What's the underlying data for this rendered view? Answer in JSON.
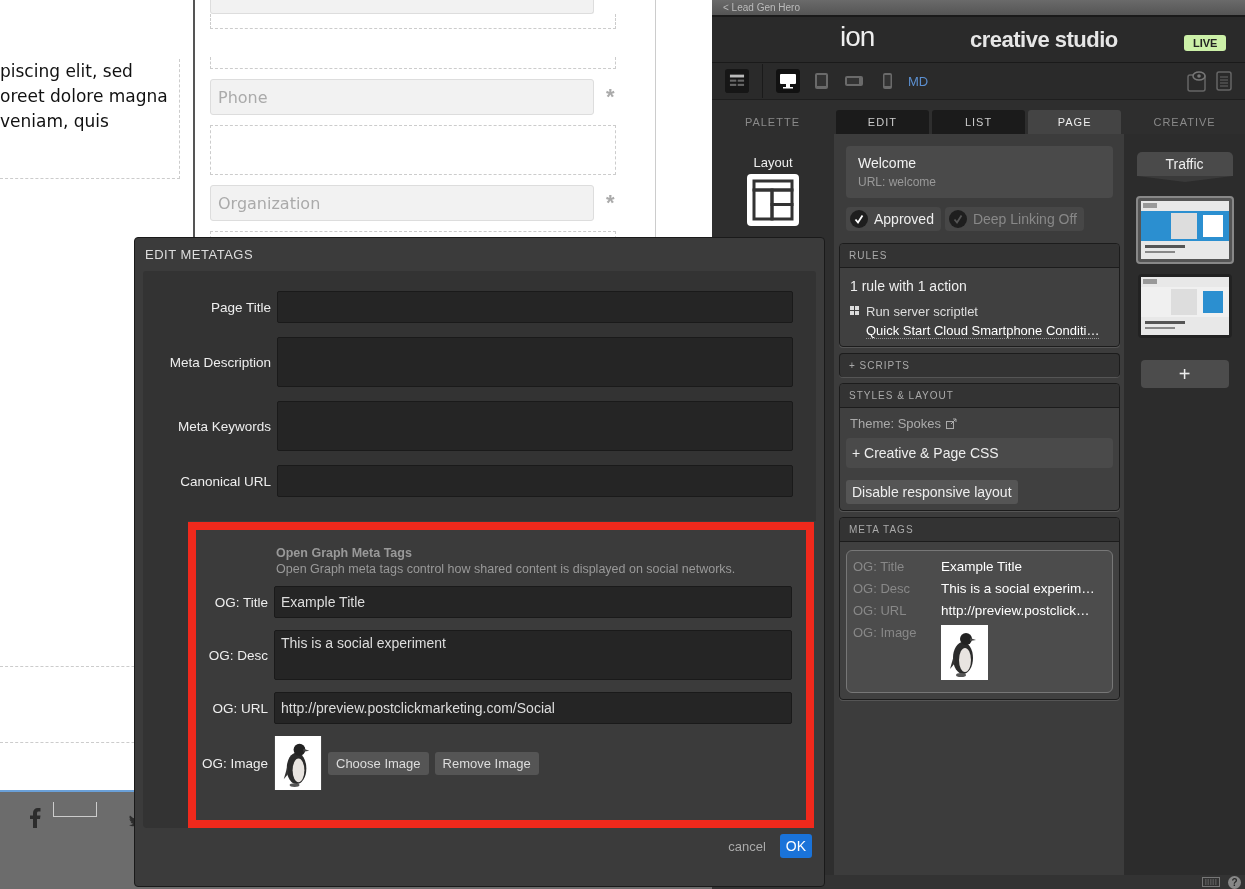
{
  "canvas": {
    "paragraph_lines": [
      "piscing elit, sed",
      "oreet dolore magna",
      "veniam, quis"
    ],
    "fields": [
      {
        "placeholder": "Phone",
        "mark": "*"
      },
      {
        "placeholder": "Organization",
        "mark": "*"
      }
    ]
  },
  "studio": {
    "back_link": "< Lead Gen Hero",
    "logo": "ion",
    "title": "creative studio",
    "status": "LIVE",
    "devices": [
      {
        "kind": "desktop",
        "selected": true
      },
      {
        "kind": "tablet",
        "selected": false
      },
      {
        "kind": "landscape",
        "selected": false
      },
      {
        "kind": "phone",
        "selected": false
      }
    ],
    "breakpoint": "MD",
    "tabs": [
      {
        "label": "PALETTE",
        "kind": "plain",
        "selected": false
      },
      {
        "label": "EDIT",
        "kind": "tab",
        "selected": false
      },
      {
        "label": "LIST",
        "kind": "tab",
        "selected": false
      },
      {
        "label": "PAGE",
        "kind": "tab",
        "selected": true
      },
      {
        "label": "CREATIVE",
        "kind": "plain",
        "selected": false
      }
    ],
    "layout_label": "Layout",
    "page": {
      "name": "Welcome",
      "url": "URL: welcome"
    },
    "toggles": [
      {
        "label": "Approved",
        "checked": true
      },
      {
        "label": "Deep Linking Off",
        "checked": false
      }
    ],
    "rules": {
      "heading": "RULES",
      "summary": "1 rule with 1 action",
      "action": "Run server scriptlet",
      "link": "Quick Start Cloud Smartphone Conditi…"
    },
    "scripts": "+ SCRIPTS",
    "styles": {
      "heading": "STYLES & LAYOUT",
      "theme": "Theme: Spokes",
      "css": "+ Creative & Page CSS",
      "button": "Disable responsive layout"
    },
    "meta_tags": {
      "heading": "META TAGS",
      "rows": [
        {
          "label": "OG: Title",
          "kind": "text",
          "value": "Example Title"
        },
        {
          "label": "OG: Desc",
          "kind": "text",
          "value": "This is a social experim…"
        },
        {
          "label": "OG: URL",
          "kind": "text",
          "value": "http://preview.postclick…"
        },
        {
          "label": "OG: Image"
        }
      ]
    },
    "traffic": "Traffic",
    "thumbnails": [
      {
        "selected": true
      },
      {
        "selected": false
      }
    ],
    "add": "+",
    "help": "?"
  },
  "dialog": {
    "title": "EDIT METATAGS",
    "fields": [
      {
        "label": "Page Title",
        "kind": "input"
      },
      {
        "label": "Meta Description",
        "kind": "textarea"
      },
      {
        "label": "Meta Keywords",
        "kind": "textarea"
      },
      {
        "label": "Canonical URL",
        "kind": "input"
      }
    ],
    "og": {
      "heading": "Open Graph Meta Tags",
      "description": "Open Graph meta tags control how shared content is displayed on social networks.",
      "fields": [
        {
          "label": "OG: Title",
          "kind": "input",
          "value": "Example Title"
        },
        {
          "label": "OG: Desc",
          "kind": "textarea",
          "value": "This is a social experiment"
        },
        {
          "label": "OG: URL",
          "kind": "input",
          "value": "http://preview.postclickmarketing.com/Social"
        },
        {
          "label": "OG: Image",
          "buttons": [
            "Choose Image",
            "Remove Image"
          ]
        }
      ]
    },
    "cancel": "cancel",
    "ok": "OK"
  }
}
